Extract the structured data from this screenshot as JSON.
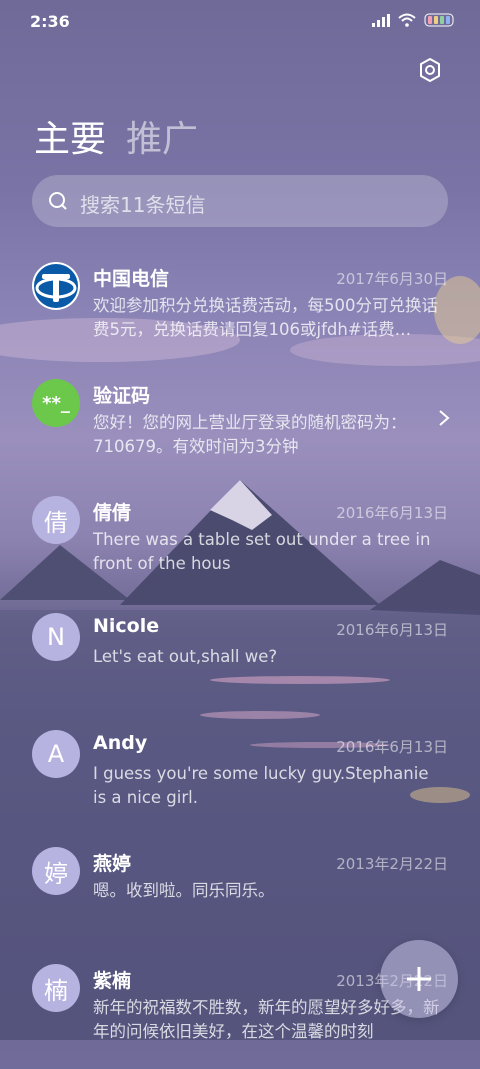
{
  "status_bar": {
    "time": "2:36"
  },
  "tabs": {
    "primary": "主要",
    "promo": "推广"
  },
  "search": {
    "placeholder": "搜索11条短信"
  },
  "conversations": [
    {
      "name": "中国电信",
      "date": "2017年6月30日",
      "preview": "欢迎参加积分兑换话费活动，每500分可兑换话费5元，兑换话费请回复106或jfdh#话费…",
      "avatar": "telecom-logo"
    },
    {
      "name": "验证码",
      "date": "",
      "preview": "您好！您的网上营业厅登录的随机密码为：710679。有效时间为3分钟",
      "avatar_text": "**_"
    },
    {
      "name": "倩倩",
      "date": "2016年6月13日",
      "preview": "There was a table set out under a tree in front of the hous",
      "avatar_text": "倩"
    },
    {
      "name": "Nicole",
      "date": "2016年6月13日",
      "preview": "Let's eat out,shall we?",
      "avatar_text": "N"
    },
    {
      "name": "Andy",
      "date": "2016年6月13日",
      "preview": "I guess you're some lucky guy.Stephanie is a nice girl.",
      "avatar_text": "A"
    },
    {
      "name": "燕婷",
      "date": "2013年2月22日",
      "preview": "嗯。收到啦。同乐同乐。",
      "avatar_text": "婷"
    },
    {
      "name": "紫楠",
      "date": "2013年2月22日",
      "preview": "新年的祝福数不胜数，新年的愿望好多好多，新年的问候依旧美好，在这个温馨的时刻",
      "avatar_text": "楠"
    }
  ],
  "colors": {
    "verify_avatar": "#6cc84a",
    "telecom_blue": "#0b5aa8",
    "letter_avatar": "#b7b3e0"
  }
}
